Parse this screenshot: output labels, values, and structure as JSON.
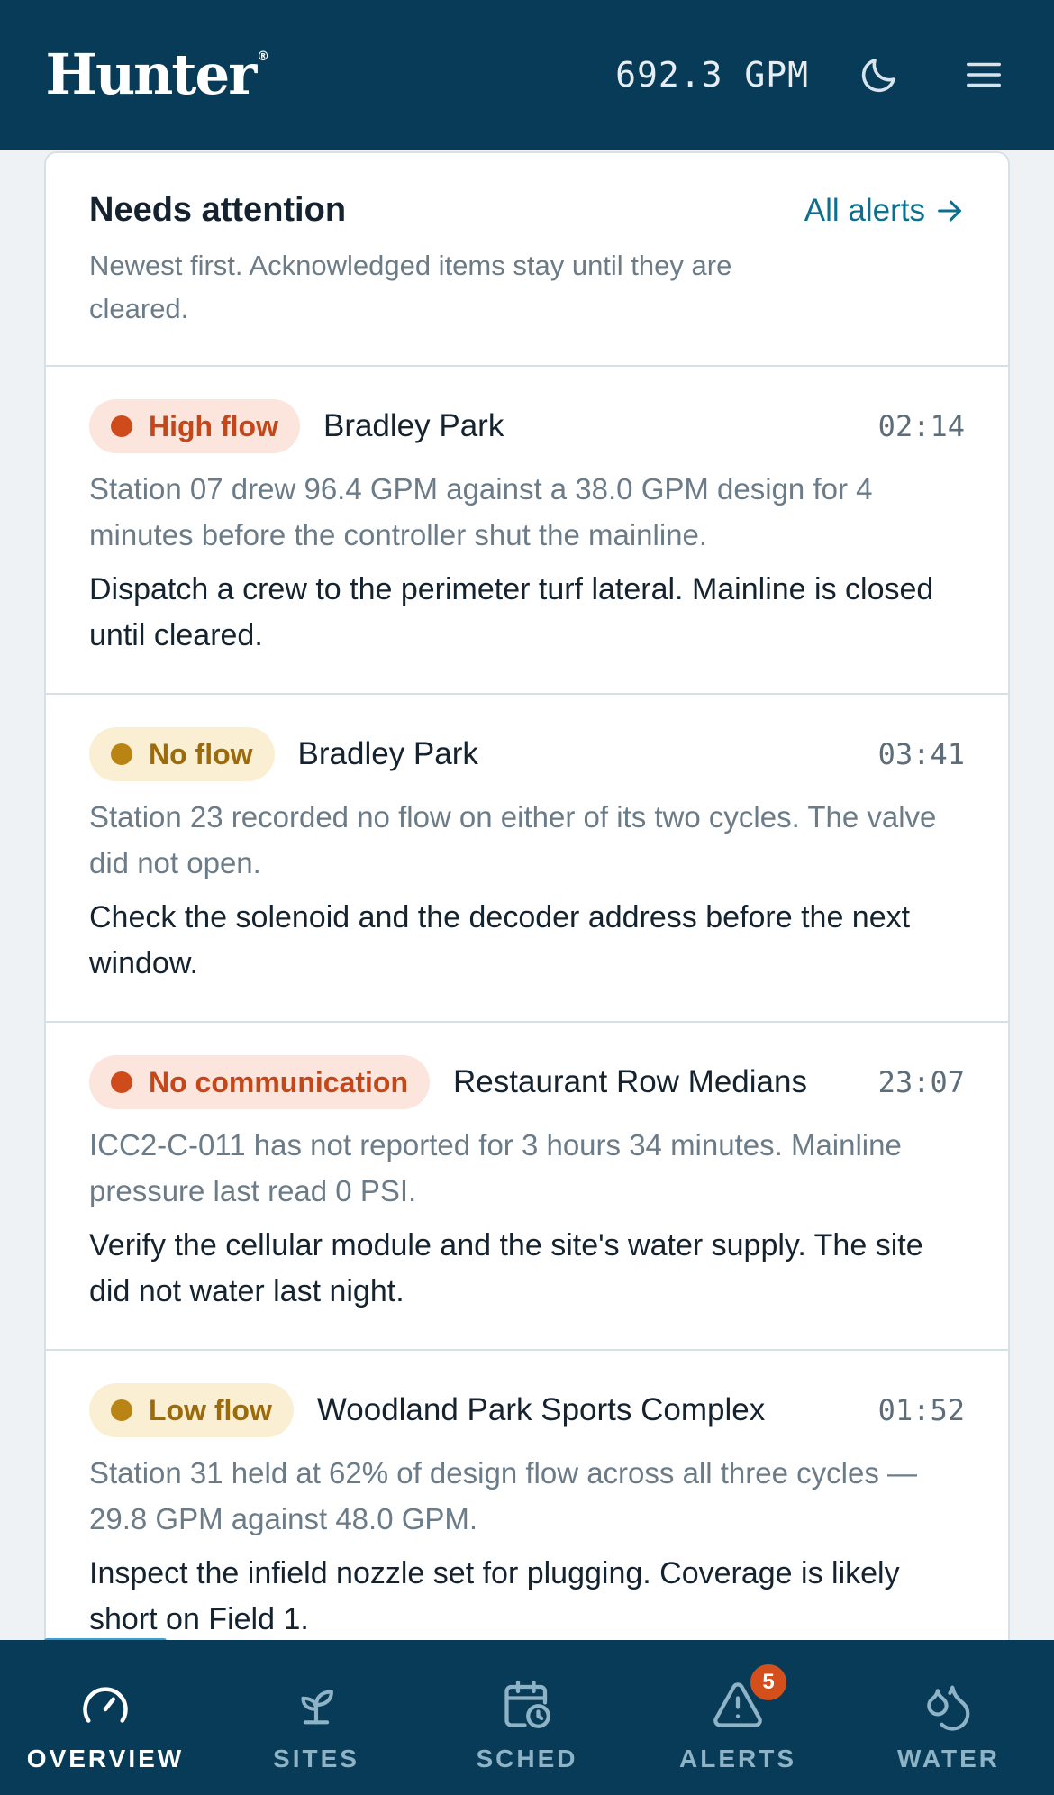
{
  "header": {
    "logo_text": "Hunter",
    "logo_mark": "®",
    "flow_readout": "692.3 GPM",
    "moon_icon": "moon-icon",
    "menu_icon": "menu-icon"
  },
  "attention": {
    "title": "Needs attention",
    "subtitle": "Newest first. Acknowledged items stay until they are cleared.",
    "all_alerts_label": "All alerts",
    "alerts": [
      {
        "type": "High flow",
        "severity": "red",
        "site": "Bradley Park",
        "time": "02:14",
        "description": "Station 07 drew 96.4 GPM against a 38.0 GPM design for 4 minutes before the controller shut the mainline.",
        "action": "Dispatch a crew to the perimeter turf lateral. Mainline is closed until cleared."
      },
      {
        "type": "No flow",
        "severity": "amber",
        "site": "Bradley Park",
        "time": "03:41",
        "description": "Station 23 recorded no flow on either of its two cycles. The valve did not open.",
        "action": "Check the solenoid and the decoder address before the next window."
      },
      {
        "type": "No communication",
        "severity": "red",
        "site": "Restaurant Row Medians",
        "time": "23:07",
        "description": "ICC2-C-011 has not reported for 3 hours 34 minutes. Mainline pressure last read 0 PSI.",
        "action": "Verify the cellular module and the site's water supply. The site did not water last night."
      },
      {
        "type": "Low flow",
        "severity": "amber",
        "site": "Woodland Park Sports Complex",
        "time": "01:52",
        "description": "Station 31 held at 62% of design flow across all three cycles — 29.8 GPM against 48.0 GPM.",
        "action": "Inspect the infield nozzle set for plugging. Coverage is likely short on Field 1."
      }
    ]
  },
  "nav": {
    "items": [
      {
        "label": "OVERVIEW",
        "icon": "gauge-icon",
        "active": true
      },
      {
        "label": "SITES",
        "icon": "sprout-icon"
      },
      {
        "label": "SCHED",
        "icon": "calendar-clock-icon"
      },
      {
        "label": "ALERTS",
        "icon": "warning-icon",
        "badge": "5"
      },
      {
        "label": "WATER",
        "icon": "droplets-icon"
      }
    ]
  },
  "colors": {
    "brand_navy": "#083b57",
    "link": "#0d6f8f",
    "red_status": "#cf4b1c",
    "amber_status": "#b98414"
  }
}
